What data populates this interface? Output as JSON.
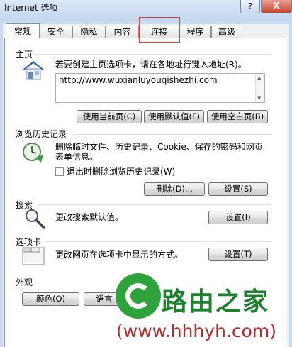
{
  "window": {
    "title": "Internet 选项",
    "help_label": "?",
    "close_label": "X"
  },
  "tabs": [
    {
      "label": "常规"
    },
    {
      "label": "安全"
    },
    {
      "label": "隐私"
    },
    {
      "label": "内容"
    },
    {
      "label": "连接"
    },
    {
      "label": "程序"
    },
    {
      "label": "高级"
    }
  ],
  "homepage": {
    "section": "主页",
    "description": "若要创建主页选项卡，请在各地址行键入地址(R)。",
    "url": "http://www.wuxianluyouqishezhi.com",
    "btn_current": "使用当前页(C)",
    "btn_default": "使用默认值(F)",
    "btn_blank": "使用空白页(B)"
  },
  "history": {
    "section": "浏览历史记录",
    "description_line1": "删除临时文件、历史记录、Cookie、保存的密码和网页",
    "description_line2": "表单信息。",
    "checkbox_label": "退出时删除浏览历史记录(W)",
    "btn_delete": "删除(D)...",
    "btn_settings": "设置(S)"
  },
  "search": {
    "section": "搜索",
    "description": "更改搜索默认值。",
    "btn_settings": "设置(I)"
  },
  "tabs_section": {
    "section": "选项卡",
    "description": "更改网页在选项卡中显示的方式。",
    "btn_settings": "设置(T)"
  },
  "appearance": {
    "section": "外观",
    "btn_colors": "颜色(O)",
    "btn_languages": "语言"
  },
  "watermark": {
    "title": "路由之家",
    "url": "(www.hhhyh.com)"
  }
}
